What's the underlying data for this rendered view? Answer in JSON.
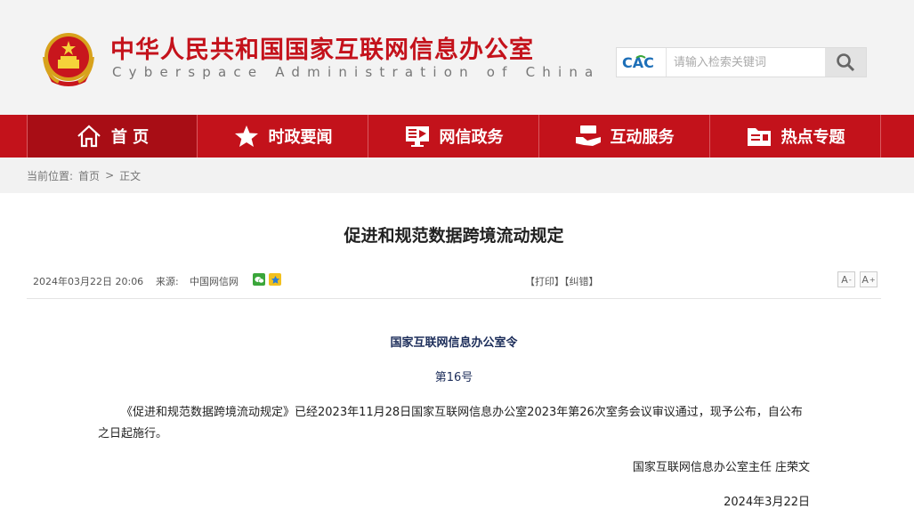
{
  "header": {
    "title": "中华人民共和国国家互联网信息办公室",
    "subtitle": "Cyberspace Administration of China",
    "search": {
      "logo_text": "CAC",
      "placeholder": "请输入检索关键词"
    }
  },
  "nav": {
    "items": [
      {
        "label": "首 页",
        "icon": "home-icon"
      },
      {
        "label": "时政要闻",
        "icon": "star-icon"
      },
      {
        "label": "网信政务",
        "icon": "monitor-icon"
      },
      {
        "label": "互动服务",
        "icon": "handshake-icon"
      },
      {
        "label": "热点专题",
        "icon": "folder-icon"
      }
    ]
  },
  "breadcrumb": {
    "label": "当前位置:",
    "home": "首页",
    "separator": ">",
    "current": "正文"
  },
  "article": {
    "title": "促进和规范数据跨境流动规定",
    "date": "2024年03月22日 20:06",
    "source_label": "来源:",
    "source": "中国网信网",
    "print_label": "【打印】",
    "error_label": "【纠错】",
    "font_small": "A",
    "font_large": "A",
    "order": "国家互联网信息办公室令",
    "number": "第16号",
    "paragraph": "《促进和规范数据跨境流动规定》已经2023年11月28日国家互联网信息办公室2023年第26次室务会议审议通过，现予公布，自公布之日起施行。",
    "signature": "国家互联网信息办公室主任 庄荣文",
    "sign_date": "2024年3月22日"
  },
  "colors": {
    "brand_red": "#c3121b",
    "nav_active": "#a80d15"
  }
}
